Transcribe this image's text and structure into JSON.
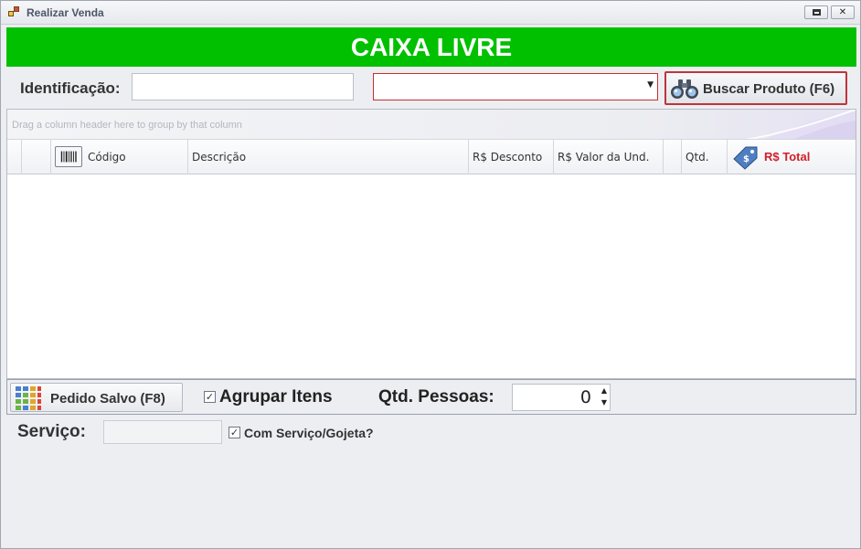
{
  "window": {
    "title": "Realizar Venda"
  },
  "banner": {
    "text": "CAIXA LIVRE"
  },
  "identification": {
    "label": "Identificação:",
    "value": ""
  },
  "product_combo": {
    "value": ""
  },
  "search_button": {
    "label": "Buscar Produto (F6)"
  },
  "grid": {
    "group_hint": "Drag a column header here to group by that column",
    "columns": {
      "codigo": "Código",
      "descricao": "Descrição",
      "desconto": "R$ Desconto",
      "valor_und": "R$ Valor da Und.",
      "qtd": "Qtd.",
      "total": "R$ Total"
    },
    "rows": []
  },
  "bottom": {
    "saved_order_label": "Pedido Salvo (F8)",
    "group_items_label": "Agrupar Itens",
    "group_items_checked": true,
    "people_label": "Qtd. Pessoas:",
    "people_value": "0"
  },
  "service": {
    "label": "Serviço:",
    "value": "",
    "with_service_label": "Com Serviço/Gojeta?",
    "with_service_checked": true
  },
  "colors": {
    "banner": "#00c000",
    "total_header": "#d0202a",
    "search_border": "#c0333a"
  },
  "icons": {
    "app": "app-window-icon",
    "search": "binoculars-icon",
    "barcode": "barcode-icon",
    "total": "price-tag-icon",
    "saved": "grid-colors-icon"
  }
}
